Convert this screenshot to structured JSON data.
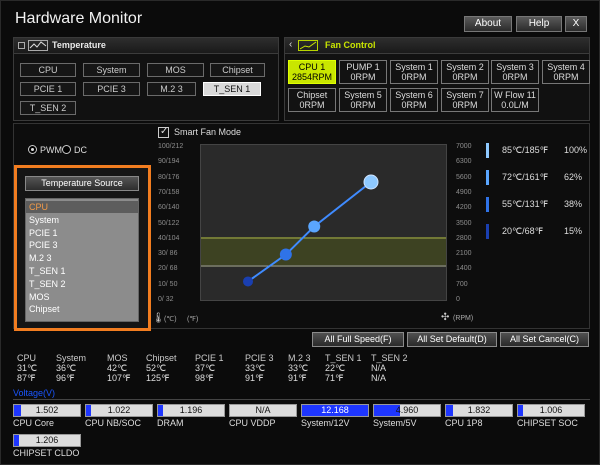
{
  "window": {
    "title": "Hardware Monitor"
  },
  "top_buttons": {
    "about": "About",
    "help": "Help",
    "close": "X"
  },
  "temperature_panel": {
    "title": "Temperature",
    "icon": "thermometer-graph-icon",
    "buttons": [
      "CPU",
      "System",
      "MOS",
      "Chipset",
      "PCIE 1",
      "PCIE 3",
      "M.2 3",
      "T_SEN 1",
      "T_SEN 2"
    ],
    "selected": "T_SEN 1"
  },
  "fan_panel": {
    "title": "Fan Control",
    "icon": "fan-graph-icon",
    "back_icon": "chevron-left-icon",
    "fans": [
      {
        "name": "CPU 1",
        "value": "2854RPM",
        "active": true
      },
      {
        "name": "PUMP 1",
        "value": "0RPM"
      },
      {
        "name": "System 1",
        "value": "0RPM"
      },
      {
        "name": "System 2",
        "value": "0RPM"
      },
      {
        "name": "System 3",
        "value": "0RPM"
      },
      {
        "name": "System 4",
        "value": "0RPM"
      },
      {
        "name": "Chipset",
        "value": "0RPM"
      },
      {
        "name": "System 5",
        "value": "0RPM"
      },
      {
        "name": "System 6",
        "value": "0RPM"
      },
      {
        "name": "System 7",
        "value": "0RPM"
      },
      {
        "name": "W Flow 11",
        "value": "0.0L/M"
      }
    ]
  },
  "mode": {
    "pwm": "PWM",
    "dc": "DC",
    "selected": "PWM"
  },
  "temperature_source": {
    "title": "Temperature Source",
    "items": [
      "CPU",
      "System",
      "PCIE 1",
      "PCIE 3",
      "M.2 3",
      "T_SEN 1",
      "T_SEN 2",
      "MOS",
      "Chipset"
    ],
    "selected": "CPU"
  },
  "smart_fan": {
    "label": "Smart Fan Mode",
    "checked": true
  },
  "graph": {
    "temp_ticks": [
      "100/212",
      "90/194",
      "80/176",
      "70/158",
      "60/140",
      "50/122",
      "40/104",
      "30/ 86",
      "20/ 68",
      "10/ 50",
      "0/ 32"
    ],
    "rpm_ticks": [
      "7000",
      "6300",
      "5600",
      "4900",
      "4200",
      "3500",
      "2800",
      "2100",
      "1400",
      "700",
      "0"
    ],
    "unit_c": "(℃)",
    "unit_f": "(℉)",
    "unit_rpm": "(RPM)",
    "thermometer_icon": "thermometer-icon",
    "fan_icon": "fan-icon",
    "curve_points_temp_c": [
      20,
      40,
      55,
      85
    ],
    "curve_points_percent": [
      15,
      38,
      62,
      100
    ]
  },
  "legend": [
    {
      "temp": "85℃/185℉",
      "pct": "100%",
      "color": "#8ec9ff"
    },
    {
      "temp": "72℃/161℉",
      "pct": "62%",
      "color": "#5aa6ff"
    },
    {
      "temp": "55℃/131℉",
      "pct": "38%",
      "color": "#2f73e8"
    },
    {
      "temp": "20℃/68℉",
      "pct": "15%",
      "color": "#1a3fb0"
    }
  ],
  "actions": {
    "full_speed": "All Full Speed(F)",
    "set_default": "All Set Default(D)",
    "set_cancel": "All Set Cancel(C)"
  },
  "sensors": [
    {
      "name": "CPU",
      "c": "31℃",
      "f": "87℉"
    },
    {
      "name": "System",
      "c": "36℃",
      "f": "96℉"
    },
    {
      "name": "MOS",
      "c": "42℃",
      "f": "107℉"
    },
    {
      "name": "Chipset",
      "c": "52℃",
      "f": "125℉"
    },
    {
      "name": "PCIE 1",
      "c": "37℃",
      "f": "98℉"
    },
    {
      "name": "PCIE 3",
      "c": "33℃",
      "f": "91℉"
    },
    {
      "name": "M.2 3",
      "c": "33℃",
      "f": "91℉"
    },
    {
      "name": "T_SEN 1",
      "c": "22℃",
      "f": "71℉"
    },
    {
      "name": "T_SEN 2",
      "c": "N/A",
      "f": "N/A"
    }
  ],
  "voltage": {
    "label": "Voltage(V)",
    "items": [
      {
        "name": "CPU Core",
        "value": "1.502",
        "level": 0.1
      },
      {
        "name": "CPU NB/SOC",
        "value": "1.022",
        "level": 0.08
      },
      {
        "name": "DRAM",
        "value": "1.196",
        "level": 0.08
      },
      {
        "name": "CPU VDDP",
        "value": "N/A",
        "level": 0
      },
      {
        "name": "System/12V",
        "value": "12.168",
        "level": 1.0
      },
      {
        "name": "System/5V",
        "value": "4.960",
        "level": 0.4
      },
      {
        "name": "CPU 1P8",
        "value": "1.832",
        "level": 0.1
      },
      {
        "name": "CHIPSET SOC",
        "value": "1.006",
        "level": 0.08
      },
      {
        "name": "CHIPSET CLDO",
        "value": "1.206",
        "level": 0.08
      }
    ]
  }
}
